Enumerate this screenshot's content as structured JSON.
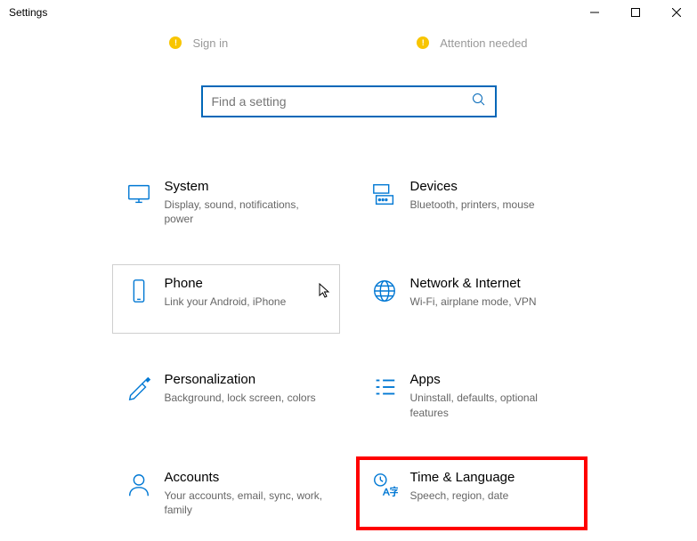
{
  "window": {
    "title": "Settings"
  },
  "status": {
    "left": "Sign in",
    "right": "Attention needed"
  },
  "search": {
    "placeholder": "Find a setting"
  },
  "tiles": {
    "system": {
      "title": "System",
      "desc": "Display, sound, notifications, power"
    },
    "devices": {
      "title": "Devices",
      "desc": "Bluetooth, printers, mouse"
    },
    "phone": {
      "title": "Phone",
      "desc": "Link your Android, iPhone"
    },
    "network": {
      "title": "Network & Internet",
      "desc": "Wi-Fi, airplane mode, VPN"
    },
    "personalization": {
      "title": "Personalization",
      "desc": "Background, lock screen, colors"
    },
    "apps": {
      "title": "Apps",
      "desc": "Uninstall, defaults, optional features"
    },
    "accounts": {
      "title": "Accounts",
      "desc": "Your accounts, email, sync, work, family"
    },
    "time": {
      "title": "Time & Language",
      "desc": "Speech, region, date"
    }
  }
}
